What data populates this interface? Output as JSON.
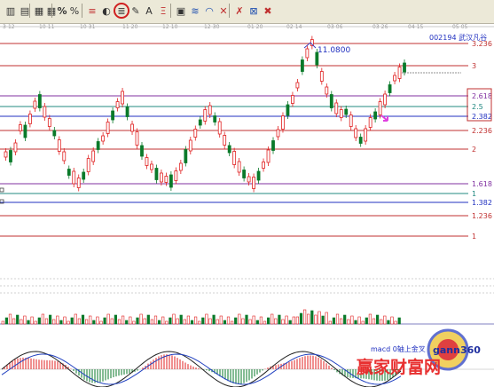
{
  "toolbar": {
    "buttons": [
      {
        "name": "candlestick-icon",
        "glyph": "▥"
      },
      {
        "name": "barchart-icon",
        "glyph": "▤"
      },
      {
        "name": "grid-icon",
        "glyph": "▦"
      },
      {
        "name": "list-icon",
        "glyph": "▦"
      },
      {
        "name": "percent-sign-icon",
        "glyph": "%"
      },
      {
        "name": "percent-icon",
        "glyph": "%"
      },
      {
        "name": "fibonacci-icon",
        "glyph": "≡"
      },
      {
        "name": "circle-icon",
        "glyph": "◐"
      },
      {
        "name": "fibo-fan-icon",
        "glyph": "≣"
      },
      {
        "name": "pen-icon",
        "glyph": "✎"
      },
      {
        "name": "draw-a-icon",
        "glyph": "A"
      },
      {
        "name": "level-icon",
        "glyph": "Ξ"
      },
      {
        "name": "draw-box-icon",
        "glyph": "▣"
      },
      {
        "name": "wave-icon",
        "glyph": "≋"
      },
      {
        "name": "arc-icon",
        "glyph": "◠"
      },
      {
        "name": "cross-icon",
        "glyph": "✕"
      },
      {
        "name": "delete-icon",
        "glyph": "✗"
      },
      {
        "name": "lock-icon",
        "glyph": "⊠"
      },
      {
        "name": "close-icon",
        "glyph": "✖"
      }
    ]
  },
  "time_axis": {
    "labels": [
      "3-12",
      "10-11",
      "10-31",
      "11-20",
      "12-10",
      "12-30",
      "01-20",
      "02-14",
      "03-06",
      "03-26",
      "04-15",
      "05-05"
    ]
  },
  "stock": {
    "code": "002194",
    "name": "武汉凡谷",
    "peak_label": "11.0800"
  },
  "fib_levels": [
    {
      "label": "3.236",
      "color": "#c03030"
    },
    {
      "label": "3",
      "color": "#c03030"
    },
    {
      "label": "2.618",
      "color": "#8030a0"
    },
    {
      "label": "2.5",
      "color": "#208880"
    },
    {
      "label": "2.382",
      "color": "#2030c0"
    },
    {
      "label": "2.236",
      "color": "#c03030"
    },
    {
      "label": "2",
      "color": "#c03030"
    },
    {
      "label": "1.618",
      "color": "#8030a0"
    },
    {
      "label": "1",
      "color": "#208880"
    },
    {
      "label": "1.382",
      "color": "#2030c0"
    },
    {
      "label": "1.236",
      "color": "#c03030"
    },
    {
      "label": "1",
      "color": "#c03030"
    }
  ],
  "macd_label": "macd 0轴上金叉",
  "watermark": {
    "brand": "gann360",
    "text": "赢家财富网"
  },
  "colors": {
    "up": "#e02020",
    "down": "#0a7a2a",
    "highlight": "#d02020",
    "arrow": "#e040e0",
    "peak": "#4040c0"
  }
}
